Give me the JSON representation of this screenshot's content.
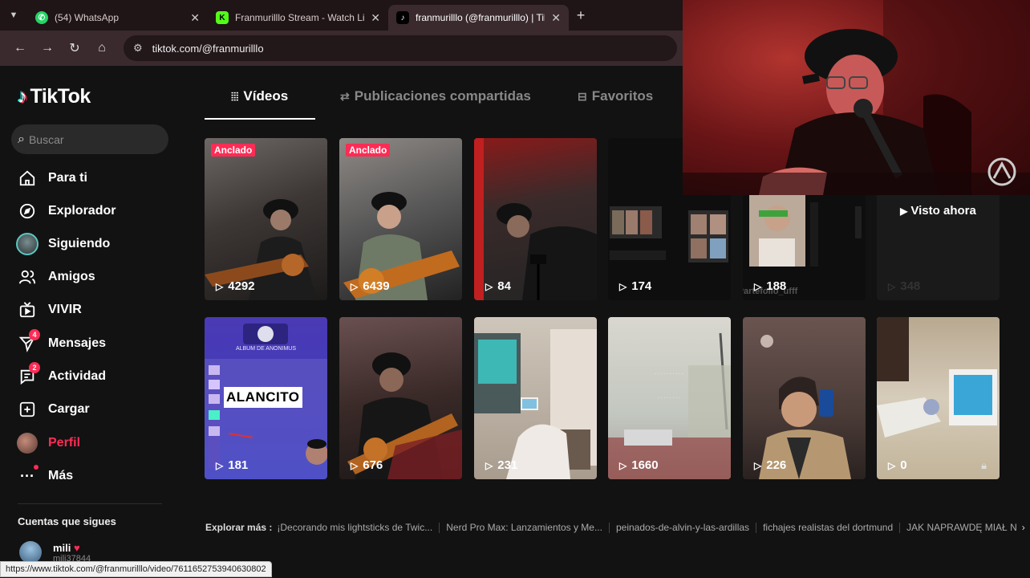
{
  "browser": {
    "tabs": [
      {
        "title": "(54) WhatsApp",
        "favicon": "whatsapp-icon",
        "active": false
      },
      {
        "title": "Franmurilllo Stream - Watch Live",
        "favicon": "kick-icon",
        "active": false
      },
      {
        "title": "franmurilllo (@franmurilllo) | TikTok",
        "favicon": "tiktok-icon",
        "active": true
      }
    ],
    "close_glyph": "✕",
    "new_tab_glyph": "+",
    "url": "tiktok.com/@franmurilllo",
    "status_url": "https://www.tiktok.com/@franmurilllo/video/7611652753940630802"
  },
  "sidebar": {
    "logo": "TikTok",
    "search_placeholder": "Buscar",
    "items": [
      {
        "label": "Para ti",
        "icon": "home-icon"
      },
      {
        "label": "Explorador",
        "icon": "compass-icon"
      },
      {
        "label": "Siguiendo",
        "icon": "following-avatar-icon"
      },
      {
        "label": "Amigos",
        "icon": "friends-icon"
      },
      {
        "label": "VIVIR",
        "icon": "live-tv-icon"
      },
      {
        "label": "Mensajes",
        "icon": "messages-icon",
        "badge": "4"
      },
      {
        "label": "Actividad",
        "icon": "activity-icon",
        "badge": "2"
      },
      {
        "label": "Cargar",
        "icon": "upload-icon"
      },
      {
        "label": "Perfil",
        "icon": "profile-avatar-icon"
      },
      {
        "label": "Más",
        "icon": "more-icon"
      }
    ],
    "following_title": "Cuentas que sigues",
    "following": [
      {
        "name": "mili",
        "handle": "mili37844"
      }
    ]
  },
  "content_tabs": [
    {
      "label": "Vídeos",
      "icon": "grid-icon",
      "active": true
    },
    {
      "label": "Publicaciones compartidas",
      "icon": "repost-icon",
      "active": false
    },
    {
      "label": "Favoritos",
      "icon": "bookmark-icon",
      "active": false
    }
  ],
  "videos": [
    {
      "views": "4292",
      "pinned": "Anclado"
    },
    {
      "views": "6439",
      "pinned": "Anclado"
    },
    {
      "views": "84"
    },
    {
      "views": "174"
    },
    {
      "views": "188",
      "overlay_caption": "GorditoPartefollo_ufff"
    },
    {
      "views": "348",
      "watched": "Visto ahora"
    },
    {
      "views": "181",
      "card_text": "ALANCITO",
      "card_header": "ALBUM DE ANONIMUS"
    },
    {
      "views": "676"
    },
    {
      "views": "231"
    },
    {
      "views": "1660"
    },
    {
      "views": "226"
    },
    {
      "views": "0",
      "locked": true
    }
  ],
  "explore": {
    "label": "Explorar más :",
    "keywords": [
      "¡Decorando mis lightsticks de Twic...",
      "Nerd Pro Max: Lanzamientos y Me...",
      "peinados-de-alvin-y-las-ardillas",
      "fichajes realistas del dortmund",
      "JAK NAPRAWDĘ MIAŁ N"
    ]
  }
}
